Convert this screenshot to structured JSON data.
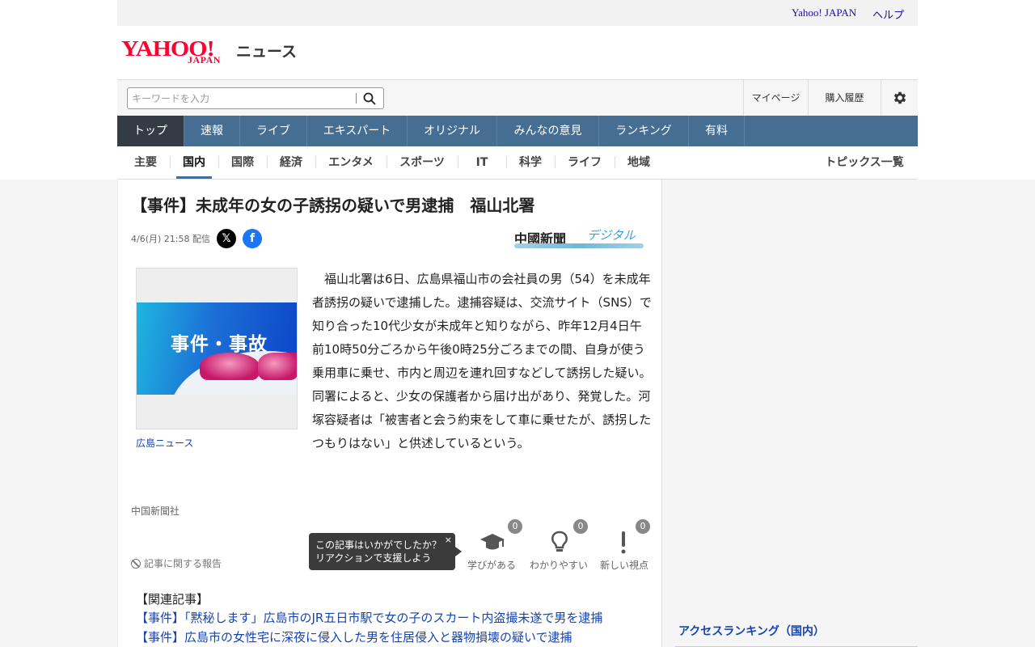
{
  "util_links": {
    "yahoo": "Yahoo! JAPAN",
    "help": "ヘルプ"
  },
  "logo": {
    "brand": "YAHOO!",
    "brand_sub": "JAPAN",
    "service": "ニュース"
  },
  "search": {
    "placeholder": "キーワードを入力"
  },
  "user_links": {
    "mypage": "マイページ",
    "history": "購入履歴"
  },
  "nav": [
    {
      "label": "トップ",
      "active": true
    },
    {
      "label": "速報"
    },
    {
      "label": "ライブ"
    },
    {
      "label": "エキスパート"
    },
    {
      "label": "オリジナル"
    },
    {
      "label": "みんなの意見"
    },
    {
      "label": "ランキング"
    },
    {
      "label": "有料"
    }
  ],
  "subnav": [
    {
      "label": "主要"
    },
    {
      "label": "国内",
      "active": true
    },
    {
      "label": "国際"
    },
    {
      "label": "経済"
    },
    {
      "label": "エンタメ"
    },
    {
      "label": "スポーツ"
    },
    {
      "label": "IT"
    },
    {
      "label": "科学"
    },
    {
      "label": "ライフ"
    },
    {
      "label": "地域"
    }
  ],
  "topics_link": "トピックス一覧",
  "article": {
    "title": "【事件】未成年の女の子誘拐の疑いで男逮捕　福山北署",
    "date": "4/6(月) 21:58 配信",
    "publisher_logo": "中國新聞",
    "publisher_logo_sub": "デジタル",
    "photo_label": "事件・事故",
    "photo_caption": "広島ニュース",
    "body": "福山北署は6日、広島県福山市の会社員の男（54）を未成年者誘拐の疑いで逮捕した。逮捕容疑は、交流サイト（SNS）で知り合った10代少女が未成年と知りながら、昨年12月4日午前10時50分ごろから午後0時25分ごろまでの間、自身が使う乗用車に乗せ、市内と周辺を連れ回すなどして誘拐した疑い。同署によると、少女の保護者から届け出があり、発覚した。河塚容疑者は「被害者と会う約束をして車に乗せたが、誘拐したつもりはない」と供述しているという。",
    "source": "中国新聞社",
    "report": "記事に関する報告"
  },
  "tooltip": {
    "line1": "この記事はいかがでしたか？",
    "line2": "リアクションで支援しよう",
    "close": "×"
  },
  "reactions": [
    {
      "label": "学びがある",
      "count": "0",
      "icon": "graduation-cap-icon"
    },
    {
      "label": "わかりやすい",
      "count": "0",
      "icon": "lightbulb-icon"
    },
    {
      "label": "新しい視点",
      "count": "0",
      "icon": "exclamation-icon"
    }
  ],
  "related": {
    "heading": "【関連記事】",
    "items": [
      "【事件】「黙秘します」広島市のJR五日市駅で女の子のスカート内盗撮未遂で男を逮捕",
      "【事件】広島市の女性宅に深夜に侵入した男を住居侵入と器物損壊の疑いで逮捕"
    ]
  },
  "sidebar": {
    "ranking_title": "アクセスランキング（国内）"
  }
}
